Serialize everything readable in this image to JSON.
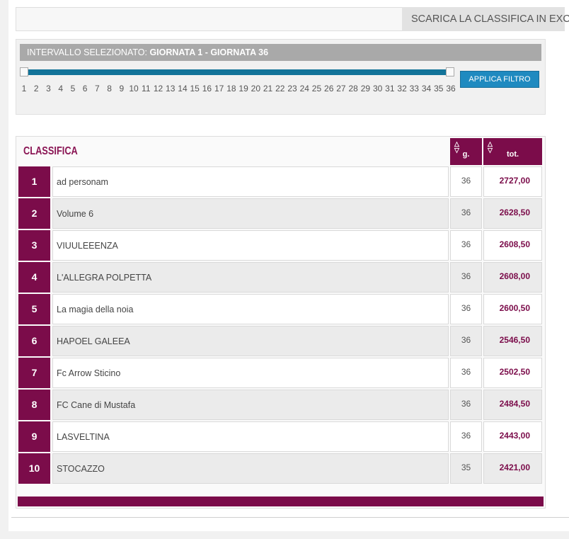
{
  "download": {
    "label": "SCARICA LA CLASSIFICA IN EXCEL"
  },
  "filter": {
    "interval_prefix": "INTERVALLO SELEZIONATO:",
    "interval_value": "GIORNATA 1 - GIORNATA 36",
    "range_min": 1,
    "range_max": 36,
    "selected_from": 1,
    "selected_to": 36,
    "ticks": [
      "1",
      "2",
      "3",
      "4",
      "5",
      "6",
      "7",
      "8",
      "9",
      "10",
      "11",
      "12",
      "13",
      "14",
      "15",
      "16",
      "17",
      "18",
      "19",
      "20",
      "21",
      "22",
      "23",
      "24",
      "25",
      "26",
      "27",
      "28",
      "29",
      "30",
      "31",
      "32",
      "33",
      "34",
      "35",
      "36"
    ],
    "apply_label": "APPLICA FILTRO",
    "track_color": "#127399",
    "button_color": "#1f8ac0"
  },
  "standings": {
    "title": "CLASSIFICA",
    "col_games": "g.",
    "col_total": "tot.",
    "sort_icon": "sort-arrows-icon",
    "accent_color": "#7b0c4a",
    "rows": [
      {
        "pos": "1",
        "team": "ad personam",
        "games": "36",
        "total": "2727,00"
      },
      {
        "pos": "2",
        "team": "Volume 6",
        "games": "36",
        "total": "2628,50"
      },
      {
        "pos": "3",
        "team": "VIUULEEENZA",
        "games": "36",
        "total": "2608,50"
      },
      {
        "pos": "4",
        "team": "L'ALLEGRA POLPETTA",
        "games": "36",
        "total": "2608,00"
      },
      {
        "pos": "5",
        "team": "La magia della noia",
        "games": "36",
        "total": "2600,50"
      },
      {
        "pos": "6",
        "team": "HAPOEL GALEEA",
        "games": "36",
        "total": "2546,50"
      },
      {
        "pos": "7",
        "team": "Fc Arrow Sticino",
        "games": "36",
        "total": "2502,50"
      },
      {
        "pos": "8",
        "team": "FC Cane di Mustafa",
        "games": "36",
        "total": "2484,50"
      },
      {
        "pos": "9",
        "team": "LASVELTINA",
        "games": "36",
        "total": "2443,00"
      },
      {
        "pos": "10",
        "team": "STOCAZZO",
        "games": "35",
        "total": "2421,00"
      }
    ]
  }
}
